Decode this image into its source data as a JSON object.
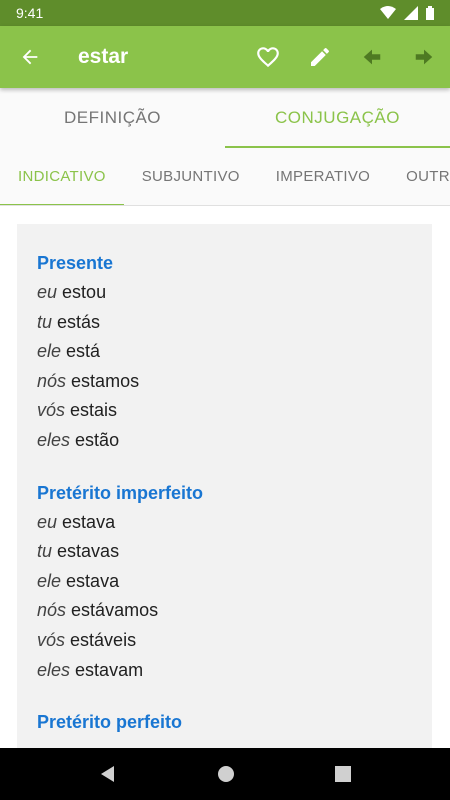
{
  "status_bar": {
    "time": "9:41"
  },
  "app_bar": {
    "title": "estar",
    "back_icon": "arrow-left-icon",
    "action_icons": [
      "heart-outline-icon",
      "pencil-icon",
      "previous-arrow-icon",
      "next-arrow-icon"
    ]
  },
  "main_tabs": [
    {
      "label": "DEFINIÇÃO",
      "active": false
    },
    {
      "label": "CONJUGAÇÃO",
      "active": true
    }
  ],
  "mood_tabs": [
    {
      "label": "INDICATIVO",
      "active": true
    },
    {
      "label": "SUBJUNTIVO",
      "active": false
    },
    {
      "label": "IMPERATIVO",
      "active": false
    },
    {
      "label": "OUTROS",
      "active": false
    }
  ],
  "tenses": [
    {
      "title": "Presente",
      "rows": [
        {
          "pronoun": "eu",
          "form": "estou"
        },
        {
          "pronoun": "tu",
          "form": "estás"
        },
        {
          "pronoun": "ele",
          "form": "está"
        },
        {
          "pronoun": "nós",
          "form": "estamos"
        },
        {
          "pronoun": "vós",
          "form": "estais"
        },
        {
          "pronoun": "eles",
          "form": "estão"
        }
      ]
    },
    {
      "title": "Pretérito imperfeito",
      "rows": [
        {
          "pronoun": "eu",
          "form": "estava"
        },
        {
          "pronoun": "tu",
          "form": "estavas"
        },
        {
          "pronoun": "ele",
          "form": "estava"
        },
        {
          "pronoun": "nós",
          "form": "estávamos"
        },
        {
          "pronoun": "vós",
          "form": "estáveis"
        },
        {
          "pronoun": "eles",
          "form": "estavam"
        }
      ]
    },
    {
      "title": "Pretérito perfeito",
      "rows": []
    }
  ],
  "colors": {
    "accent": "#8bc34a",
    "status_bar": "#5f8d2b",
    "tense_title": "#1976d2",
    "card_background": "#f2f2f2"
  }
}
